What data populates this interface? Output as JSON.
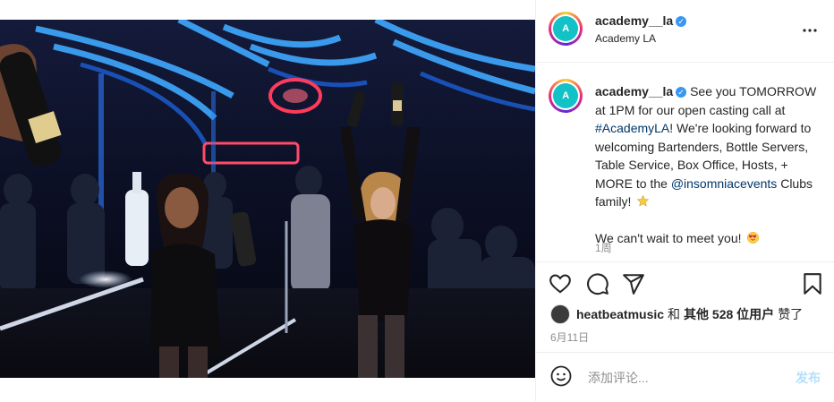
{
  "post": {
    "author": {
      "username": "academy__la",
      "subtitle": "Academy LA",
      "avatar_text": "A"
    },
    "caption": {
      "username": "academy__la",
      "text_1": "See you TOMORROW at 1PM for our open casting call at",
      "hashtag": "#AcademyLA",
      "text_2": "! We're looking forward to welcoming Bartenders, Bottle Servers, Table Service, Box Office, Hosts, + MORE to the",
      "mention": "@insomniacevents",
      "text_3": "Clubs family!",
      "line_2": "We can't wait to meet you!",
      "star_icon": "star-emoji",
      "heart_eyes_icon": "heart-eyes-emoji",
      "time_ago": "1周"
    },
    "actions": {
      "like_icon": "heart-icon",
      "comment_icon": "comment-icon",
      "share_icon": "send-icon",
      "save_icon": "bookmark-icon"
    },
    "likes": {
      "user": "heatbeatmusic",
      "and": "和",
      "others": "其他 528 位用户",
      "suffix": "赞了"
    },
    "date": "6月11日",
    "add_comment": {
      "placeholder": "添加评论...",
      "post_label": "发布"
    },
    "colors": {
      "accent": "#3897f0",
      "brand": "#12c2c6",
      "link": "#00376b"
    }
  }
}
